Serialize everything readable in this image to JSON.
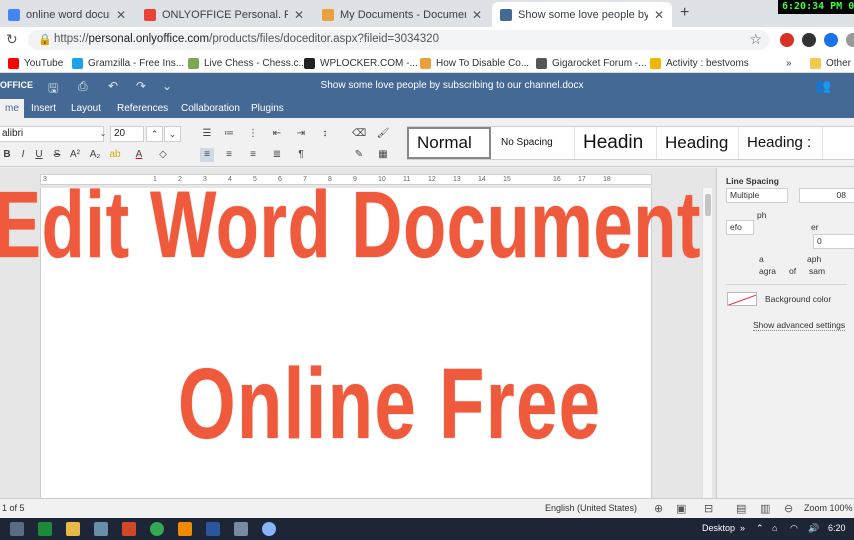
{
  "browser": {
    "tabs": [
      {
        "label": "online word documents edit",
        "favicon_color": "#4285f4",
        "active": false
      },
      {
        "label": "ONLYOFFICE Personal. Please act",
        "favicon_color": "#ea4335",
        "active": false
      },
      {
        "label": "My Documents - Documents",
        "favicon_color": "#e8a13c",
        "active": false
      },
      {
        "label": "Show some love people by subsc",
        "favicon_color": "#446995",
        "active": true
      }
    ],
    "new_tab": "+",
    "clock": "6:20:34 PM 07",
    "url_prefix": "https://",
    "url_host": "personal.onlyoffice.com",
    "url_path": "/products/files/doceditor.aspx?fileid=3034320",
    "bookmarks": [
      {
        "label": "YouTube",
        "favicon_color": "#ff0000"
      },
      {
        "label": "Gramzilla - Free Ins...",
        "favicon_color": "#1aa3e8"
      },
      {
        "label": "Live Chess - Chess.c...",
        "favicon_color": "#7fa650"
      },
      {
        "label": "WPLOCKER.COM -...",
        "favicon_color": "#222222"
      },
      {
        "label": "How To Disable Co...",
        "favicon_color": "#e8a13c"
      },
      {
        "label": "Gigarocket Forum -...",
        "favicon_color": "#555555"
      },
      {
        "label": "Activity : bestvoms",
        "favicon_color": "#f2b705"
      },
      {
        "label": "»",
        "favicon_color": ""
      },
      {
        "label": "Other bo",
        "favicon_color": "#f2c94c"
      }
    ]
  },
  "editor": {
    "brand": "OFFICE",
    "doc_title": "Show some love people by subscribing to our channel.docx",
    "menu_tabs": [
      "me",
      "Insert",
      "Layout",
      "References",
      "Collaboration",
      "Plugins"
    ],
    "active_tab_index": 0,
    "font_name": "alibri",
    "font_size": "20",
    "styles": [
      "Normal",
      "No Spacing",
      "Headin",
      "Heading",
      "Heading :"
    ],
    "selected_style_index": 0,
    "ruler_numbers": [
      "3",
      "1",
      "2",
      "3",
      "4",
      "5",
      "6",
      "7",
      "8",
      "9",
      "10",
      "11",
      "12",
      "13",
      "14",
      "15",
      "16",
      "17",
      "18"
    ],
    "right_panel": {
      "line_spacing_label": "Line Spacing",
      "line_spacing_value": "Multiple",
      "line_spacing_amount": "08",
      "fragment_1": "ph",
      "fragment_2": "efo",
      "fragment_3": "er",
      "fragment_4": "0",
      "fragment_5": "a",
      "fragment_6": "aph",
      "fragment_7": "agra",
      "fragment_8": "of",
      "fragment_9": "sam",
      "background_color_label": "Background color",
      "advanced_settings_label": "Show advanced settings"
    },
    "status": {
      "page": "1 of 5",
      "language": "English (United States)",
      "zoom": "Zoom 100%"
    }
  },
  "overlay": {
    "line1": "Edit Word Document",
    "line2": "Online Free",
    "color": "#f05a3c"
  },
  "taskbar": {
    "desktop_label": "Desktop",
    "time": "6:20"
  }
}
